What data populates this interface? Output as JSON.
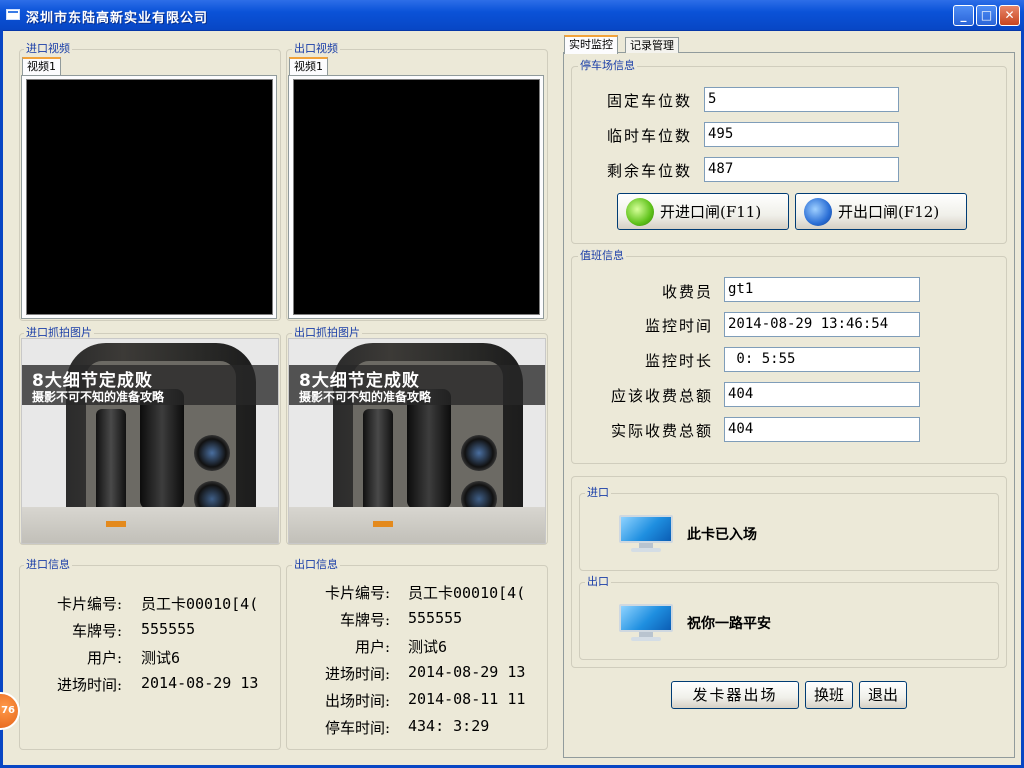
{
  "window": {
    "title": "深圳市东陆高新实业有限公司"
  },
  "entry_video": {
    "group_label": "进口视频",
    "tab": "视频1"
  },
  "exit_video": {
    "group_label": "出口视频",
    "tab": "视频1"
  },
  "entry_snapshot": {
    "group_label": "进口抓拍图片",
    "headline": "8大细节定成败",
    "subline": "摄影不可不知的准备攻略"
  },
  "exit_snapshot": {
    "group_label": "出口抓拍图片",
    "headline": "8大细节定成败",
    "subline": "摄影不可不知的准备攻略"
  },
  "entry_info": {
    "group_label": "进口信息",
    "rows": [
      {
        "label": "卡片编号:",
        "value": "员工卡00010[4("
      },
      {
        "label": "车牌号:",
        "value": "555555"
      },
      {
        "label": "用户:",
        "value": "测试6"
      },
      {
        "label": "进场时间:",
        "value": "2014-08-29 13"
      }
    ]
  },
  "exit_info": {
    "group_label": "出口信息",
    "rows": [
      {
        "label": "卡片编号:",
        "value": "员工卡00010[4("
      },
      {
        "label": "车牌号:",
        "value": "555555"
      },
      {
        "label": "用户:",
        "value": "测试6"
      },
      {
        "label": "进场时间:",
        "value": "2014-08-29 13"
      },
      {
        "label": "出场时间:",
        "value": "2014-08-11 11"
      },
      {
        "label": "停车时间:",
        "value": "434: 3:29"
      }
    ]
  },
  "right_tabs": [
    {
      "label": "实时监控"
    },
    {
      "label": "记录管理"
    }
  ],
  "parking": {
    "group_label": "停车场信息",
    "fixed_label": "固定车位数",
    "fixed_value": "5",
    "temp_label": "临时车位数",
    "temp_value": "495",
    "remain_label": "剩余车位数",
    "remain_value": "487",
    "open_entry_label": "开进口闸(F11)",
    "open_exit_label": "开出口闸(F12)"
  },
  "duty": {
    "group_label": "值班信息",
    "cashier_label": "收费员",
    "cashier_value": "gt1",
    "monitor_time_label": "监控时间",
    "monitor_time_value": "2014-08-29 13:46:54",
    "monitor_duration_label": "监控时长",
    "monitor_duration_value": " 0: 5:55",
    "due_label": "应该收费总额",
    "due_value": "404",
    "actual_label": "实际收费总额",
    "actual_value": "404"
  },
  "entry_status": {
    "group_label": "进口",
    "message": "此卡已入场"
  },
  "exit_status": {
    "group_label": "出口",
    "message": "祝你一路平安"
  },
  "bottom_buttons": {
    "dispenser": "发卡器出场",
    "shift": "换班",
    "quit": "退出"
  },
  "badge": {
    "text": "76"
  },
  "colors": {
    "titlebar": "#0a52d8",
    "group_label": "#1a3ea8",
    "face": "#ece9d8"
  }
}
